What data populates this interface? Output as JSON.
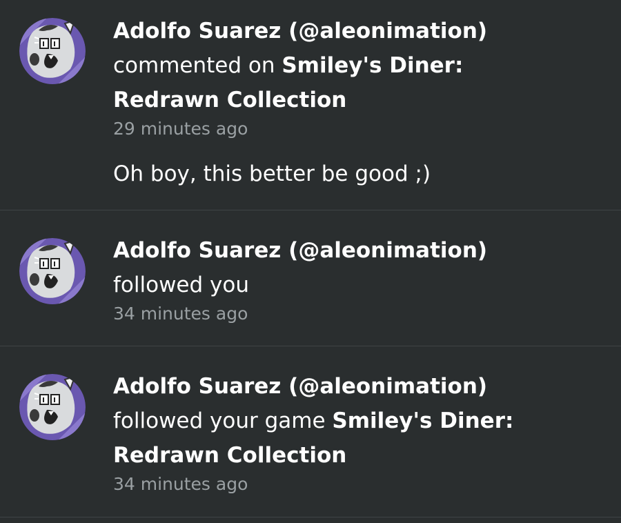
{
  "notifications": [
    {
      "user": "Adolfo Suarez (@aleonimation)",
      "action": "commented on",
      "target_line1": "Smiley's Diner:",
      "target_line2": "Redrawn Collection",
      "time": "29 minutes ago",
      "comment": "Oh boy, this better be good ;)",
      "avatar_icon": "cartoon-character-avatar"
    },
    {
      "user": "Adolfo Suarez (@aleonimation)",
      "action": "followed you",
      "time": "34 minutes ago",
      "avatar_icon": "cartoon-character-avatar"
    },
    {
      "user": "Adolfo Suarez (@aleonimation)",
      "action": "followed your game",
      "target_line1": "Smiley's Diner:",
      "target_line2": "Redrawn Collection",
      "time": "34 minutes ago",
      "avatar_icon": "cartoon-character-avatar"
    }
  ],
  "colors": {
    "background": "#2a2e2f",
    "divider": "#3f4446",
    "text": "#ffffff",
    "muted": "#9aa0a3",
    "avatar_purple": "#6a58b0"
  }
}
